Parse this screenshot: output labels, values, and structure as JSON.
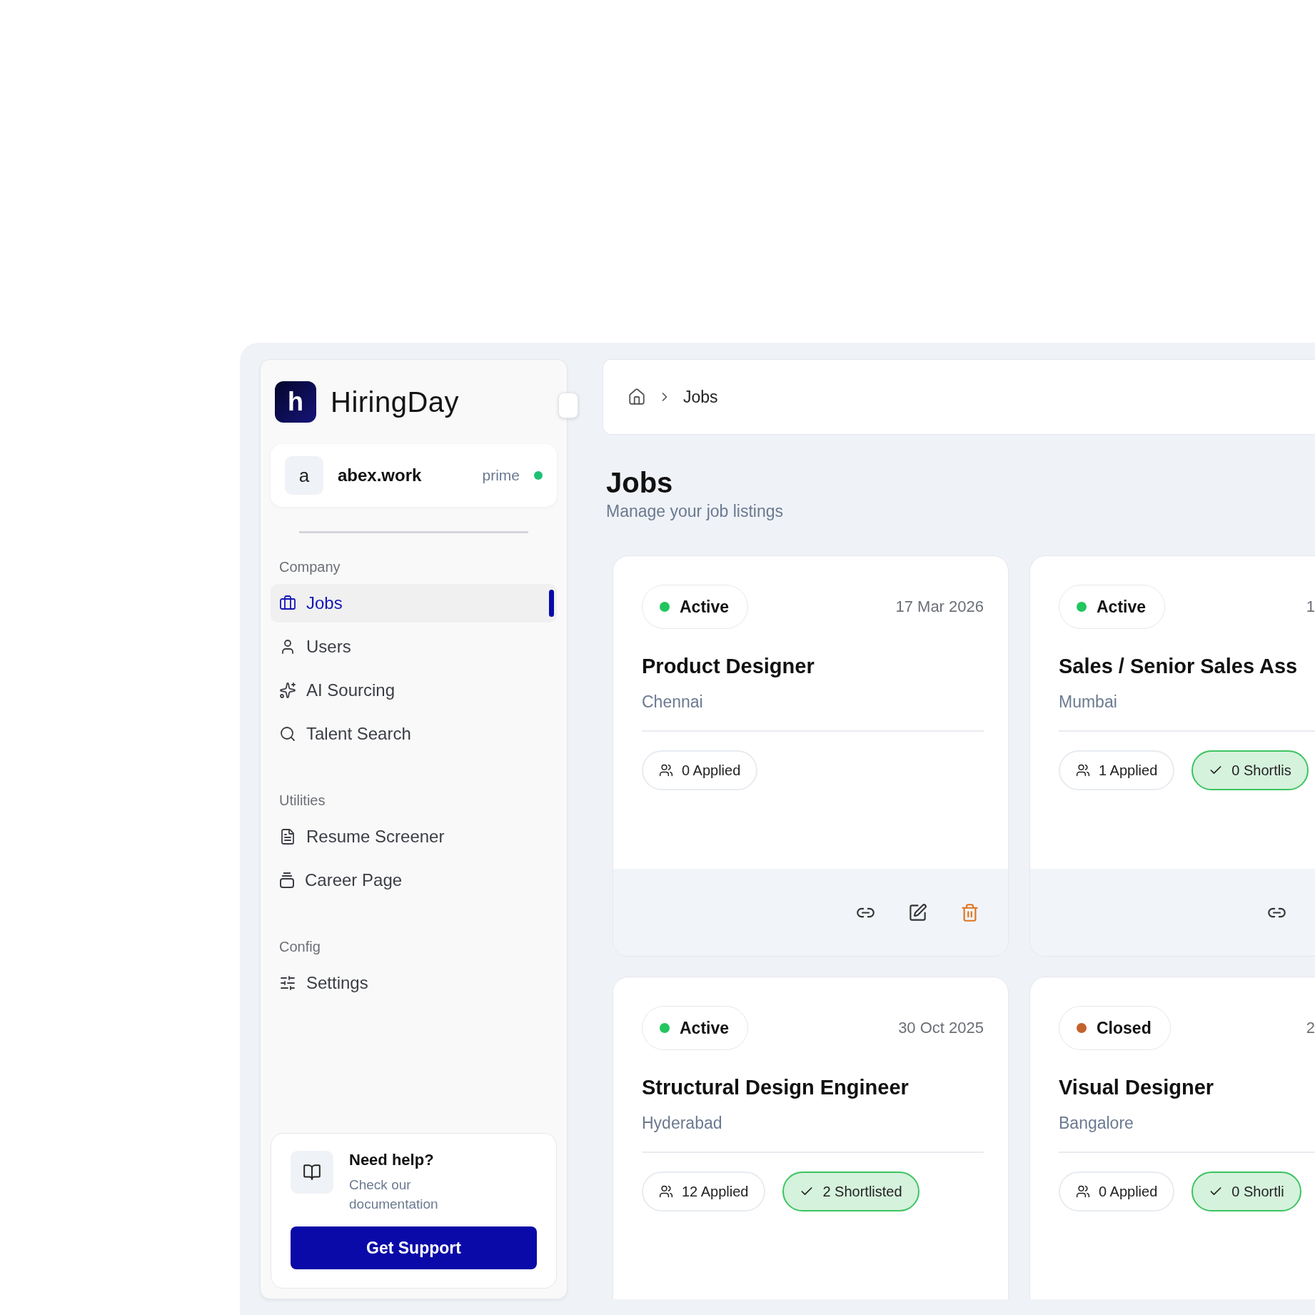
{
  "brand": {
    "name": "HiringDay",
    "logo_letter": "h"
  },
  "account": {
    "avatar": "a",
    "name": "abex.work",
    "plan": "prime"
  },
  "nav": [
    {
      "heading": "Company",
      "items": [
        {
          "label": "Jobs",
          "kind": "briefcase",
          "selected": true
        },
        {
          "label": "Users",
          "kind": "user",
          "selected": false
        },
        {
          "label": "AI Sourcing",
          "kind": "sparkles",
          "selected": false
        },
        {
          "label": "Talent Search",
          "kind": "search",
          "selected": false
        }
      ]
    },
    {
      "heading": "Utilities",
      "items": [
        {
          "label": "Resume Screener",
          "kind": "resume",
          "selected": false
        },
        {
          "label": "Career Page",
          "kind": "stack",
          "selected": false
        }
      ]
    },
    {
      "heading": "Config",
      "items": [
        {
          "label": "Settings",
          "kind": "sliders",
          "selected": false
        }
      ]
    }
  ],
  "help": {
    "title": "Need help?",
    "text": "Check our documentation",
    "button": "Get Support"
  },
  "breadcrumb": [
    "Jobs"
  ],
  "page": {
    "title": "Jobs",
    "subtitle": "Manage your job listings"
  },
  "jobs": [
    {
      "status": "Active",
      "color": "#22c55e",
      "date": "17 Mar 2026",
      "title": "Product Designer",
      "location": "Chennai",
      "applied": "0 Applied",
      "actions": [
        {
          "kind": "link"
        },
        {
          "kind": "edit"
        },
        {
          "kind": "delete"
        }
      ]
    },
    {
      "status": "Active",
      "color": "#22c55e",
      "date": "1",
      "title": "Sales / Senior Sales Ass",
      "location": "Mumbai",
      "applied": "1 Applied",
      "shortlisted": "0 Shortlis",
      "actions": [
        {
          "kind": "link"
        }
      ]
    },
    {
      "status": "Active",
      "color": "#22c55e",
      "date": "30 Oct 2025",
      "title": "Structural Design Engineer",
      "location": "Hyderabad",
      "applied": "12 Applied",
      "shortlisted": "2 Shortlisted"
    },
    {
      "status": "Closed",
      "color": "#c2622d",
      "date": "2",
      "title": "Visual Designer",
      "location": "Bangalore",
      "applied": "0 Applied",
      "shortlisted": "0 Shortli"
    }
  ]
}
